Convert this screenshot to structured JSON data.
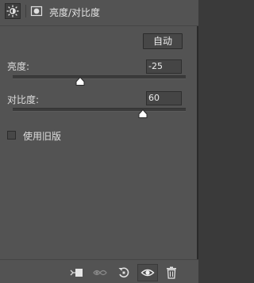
{
  "header": {
    "title": "亮度/对比度",
    "adjustment_icon": "sun-icon",
    "mask_icon": "layer-mask-icon"
  },
  "auto_button": {
    "label": "自动"
  },
  "brightness": {
    "label": "亮度:",
    "value": "-25",
    "slider_fraction": 0.39
  },
  "contrast": {
    "label": "对比度:",
    "value": "60",
    "slider_fraction": 0.75
  },
  "legacy": {
    "label": "使用旧版",
    "checked": false
  },
  "toolbar": {
    "icons": [
      "clip-to-layer-icon",
      "view-previous-state-icon",
      "reset-icon",
      "visibility-eye-icon",
      "trash-icon"
    ]
  },
  "colors": {
    "panel_bg": "#535353",
    "text": "#dedede",
    "input_bg": "#454545"
  }
}
